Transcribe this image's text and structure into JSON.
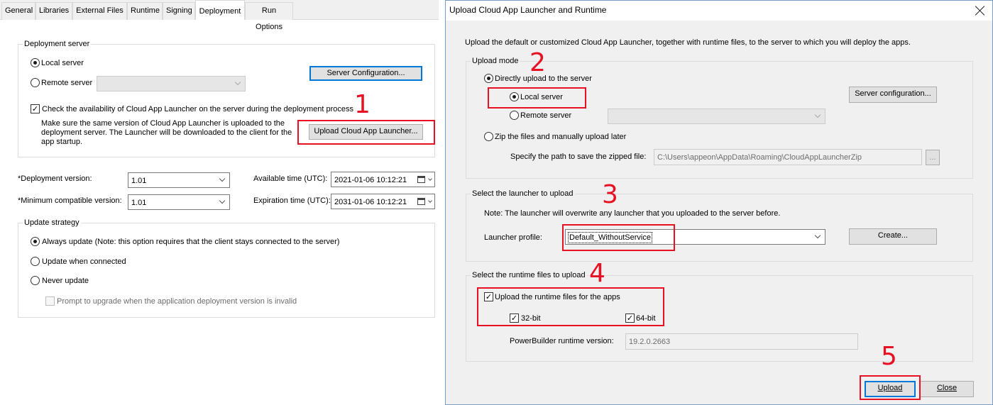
{
  "left": {
    "tabs": [
      "General",
      "Libraries",
      "External Files",
      "Runtime",
      "Signing",
      "Deployment",
      "Run Options"
    ],
    "active_tab": "Deployment",
    "deployment_server": {
      "title": "Deployment server",
      "local_server": "Local server",
      "remote_server": "Remote server",
      "server_config_button": "Server Configuration...",
      "check_label": "Check the availability of Cloud App Launcher on the server during the deployment process",
      "note_line1": "Make sure the same version of Cloud App Launcher is uploaded to the",
      "note_line2": "deployment server.  The Launcher will be downloaded to the client for the",
      "note_line3": "app startup.",
      "upload_launcher_button": "Upload Cloud App Launcher..."
    },
    "deployment_version_label": "Deployment version:",
    "deployment_version_value": "1.01",
    "min_version_label": "Minimum compatible version:",
    "min_version_value": "1.01",
    "available_time_label": "Available time (UTC):",
    "available_time_value": "2021-01-06 10:12:21",
    "expiration_time_label": "Expiration time (UTC):",
    "expiration_time_value": "2031-01-06 10:12:21",
    "required_mark": "*",
    "update_strategy": {
      "title": "Update strategy",
      "always": "Always update (Note: this option requires that the client stays connected to the server)",
      "when_connected": "Update when connected",
      "never": "Never update",
      "prompt": "Prompt to upgrade when the application deployment version is invalid"
    }
  },
  "dialog": {
    "title": "Upload Cloud App Launcher and Runtime",
    "intro": "Upload the default or customized Cloud App Launcher, together with runtime files, to the server to which you will deploy the apps.",
    "upload_mode": {
      "title": "Upload mode",
      "direct": "Directly upload to the server",
      "local": "Local server",
      "remote": "Remote server",
      "server_config_button": "Server configuration...",
      "zip": "Zip the files and manually upload later",
      "path_label": "Specify the path to save the zipped file:",
      "path_value": "C:\\Users\\appeon\\AppData\\Roaming\\CloudAppLauncherZip",
      "browse_button": "..."
    },
    "launcher": {
      "title": "Select the launcher to upload",
      "note": "Note: The launcher will overwrite any launcher that you uploaded to the server before.",
      "profile_label": "Launcher profile:",
      "profile_value": "Default_WithoutService",
      "create_button": "Create..."
    },
    "runtime": {
      "title": "Select the runtime files to upload",
      "upload_label": "Upload the runtime files for the apps",
      "bit32": "32-bit",
      "bit64": "64-bit",
      "version_label": "PowerBuilder runtime version:",
      "version_value": "19.2.0.2663"
    },
    "upload_button": "Upload",
    "close_button": "Close"
  },
  "annotations": [
    "1",
    "2",
    "3",
    "4",
    "5"
  ],
  "colors": {
    "annotation": "#e81123",
    "focus": "#0078d7"
  },
  "checkmark": "✓"
}
